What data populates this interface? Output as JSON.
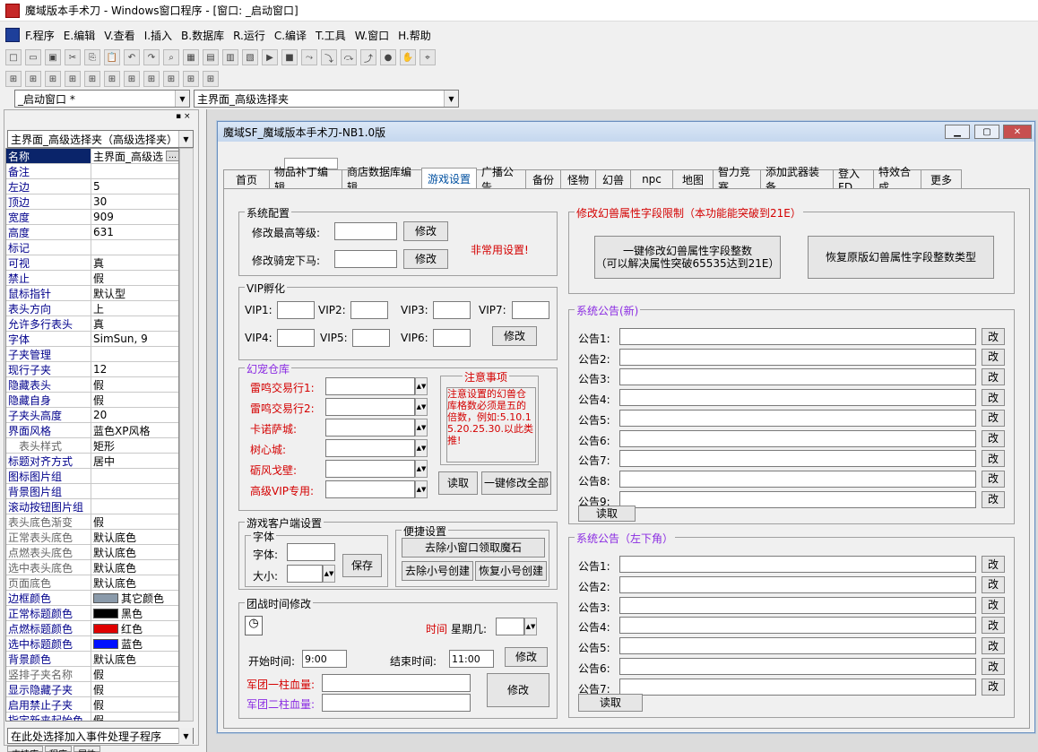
{
  "window_title": "魔域版本手术刀 - Windows窗口程序 - [窗口: _启动窗口]",
  "menu": [
    "F.程序",
    "E.编辑",
    "V.查看",
    "I.插入",
    "B.数据库",
    "R.运行",
    "C.编译",
    "T.工具",
    "W.窗口",
    "H.帮助"
  ],
  "combo_window": "_启动窗口 *",
  "combo_component": "主界面_高级选择夹",
  "left_combo": "主界面_高级选择夹（高级选择夹）",
  "props": [
    {
      "n": "名称",
      "v": "主界面_高级选"
    },
    {
      "n": "备注",
      "v": ""
    },
    {
      "n": "左边",
      "v": "5"
    },
    {
      "n": "顶边",
      "v": "30"
    },
    {
      "n": "宽度",
      "v": "909"
    },
    {
      "n": "高度",
      "v": "631"
    },
    {
      "n": "标记",
      "v": ""
    },
    {
      "n": "可视",
      "v": "真"
    },
    {
      "n": "禁止",
      "v": "假"
    },
    {
      "n": "鼠标指针",
      "v": "默认型"
    },
    {
      "n": "表头方向",
      "v": "上"
    },
    {
      "n": "允许多行表头",
      "v": "真"
    },
    {
      "n": "字体",
      "v": "SimSun, 9"
    },
    {
      "n": "子夹管理",
      "v": ""
    },
    {
      "n": "现行子夹",
      "v": "12"
    },
    {
      "n": "隐藏表头",
      "v": "假"
    },
    {
      "n": "隐藏自身",
      "v": "假"
    },
    {
      "n": "子夹头高度",
      "v": "20"
    },
    {
      "n": "界面风格",
      "v": "蓝色XP风格"
    },
    {
      "n": "表头样式",
      "v": "矩形"
    },
    {
      "n": "标题对齐方式",
      "v": "居中"
    },
    {
      "n": "图标图片组",
      "v": ""
    },
    {
      "n": "背景图片组",
      "v": ""
    },
    {
      "n": "滚动按钮图片组",
      "v": ""
    },
    {
      "n": "表头底色渐变",
      "v": "假"
    },
    {
      "n": "正常表头底色",
      "v": "默认底色"
    },
    {
      "n": "点燃表头底色",
      "v": "默认底色"
    },
    {
      "n": "选中表头底色",
      "v": "默认底色"
    },
    {
      "n": "页面底色",
      "v": "默认底色"
    },
    {
      "n": "边框颜色",
      "v": "其它颜色"
    },
    {
      "n": "正常标题颜色",
      "v": "黑色"
    },
    {
      "n": "点燃标题颜色",
      "v": "红色"
    },
    {
      "n": "选中标题颜色",
      "v": "蓝色"
    },
    {
      "n": "背景颜色",
      "v": "默认底色"
    },
    {
      "n": "竖排子夹名称",
      "v": "假"
    },
    {
      "n": "显示隐藏子夹",
      "v": "假"
    },
    {
      "n": "启用禁止子夹",
      "v": "假"
    },
    {
      "n": "指定新夹起始色",
      "v": "假"
    }
  ],
  "event_combo": "在此处选择加入事件处理子程序",
  "bottom_tabs": [
    "支持库",
    "程序",
    "属性"
  ],
  "form_title": "魔域SF_魔域版本手术刀-NB1.0版",
  "tabs": [
    "首页",
    "物品补丁编辑",
    "商店数据库编辑",
    "游戏设置",
    "广播公告",
    "备份",
    "怪物",
    "幻兽",
    "npc",
    "地图",
    "智力竞赛",
    "添加武器装备",
    "登入FD",
    "特效合成",
    "更多"
  ],
  "sys": {
    "title": "系统配置",
    "l1": "修改最高等级:",
    "l2": "修改骑宠下马:",
    "btn": "修改",
    "note": "非常用设置!"
  },
  "vip": {
    "title": "VIP孵化",
    "labels": [
      "VIP1:",
      "VIP2:",
      "VIP3:",
      "VIP7:",
      "VIP4:",
      "VIP5:",
      "VIP6:"
    ],
    "btn": "修改"
  },
  "pet": {
    "title": "幻宠仓库",
    "labels": [
      "雷鸣交易行1:",
      "雷鸣交易行2:",
      "卡诺萨城:",
      "树心城:",
      "砺风戈壁:",
      "高级VIP专用:"
    ],
    "note_title": "注意事项",
    "note": "注意设置的幻兽仓库格数必须是五的倍数，例如:5.10.15.20.25.30.以此类推!",
    "read": "读取",
    "modall": "一键修改全部"
  },
  "client": {
    "title": "游戏客户端设置",
    "font_title": "字体",
    "font_lbl": "字体:",
    "size_lbl": "大小:",
    "save": "保存",
    "conv_title": "便捷设置",
    "b1": "去除小窗口领取魔石",
    "b2": "去除小号创建",
    "b3": "恢复小号创建"
  },
  "war": {
    "title": "团战时间修改",
    "time_lbl": "时间",
    "week_lbl": "星期几:",
    "start_lbl": "开始时间:",
    "start_val": "9:00",
    "end_lbl": "结束时间:",
    "end_val": "11:00",
    "btn": "修改",
    "hp1": "军团一柱血量:",
    "hp2": "军团二柱血量:",
    "btn2": "修改"
  },
  "beast": {
    "title": "修改幻兽属性字段限制（本功能能突破到21E）",
    "b1": "一键修改幻兽属性字段整数\n（可以解决属性突破65535达到21E）",
    "b2": "恢复原版幻兽属性字段整数类型"
  },
  "notice_new": {
    "title": "系统公告(新)",
    "labels": [
      "公告1:",
      "公告2:",
      "公告3:",
      "公告4:",
      "公告5:",
      "公告6:",
      "公告7:",
      "公告8:",
      "公告9:"
    ],
    "btn": "改",
    "read": "读取"
  },
  "notice_lb": {
    "title": "系统公告（左下角）",
    "labels": [
      "公告1:",
      "公告2:",
      "公告3:",
      "公告4:",
      "公告5:",
      "公告6:",
      "公告7:"
    ],
    "btn": "改",
    "read": "读取"
  }
}
